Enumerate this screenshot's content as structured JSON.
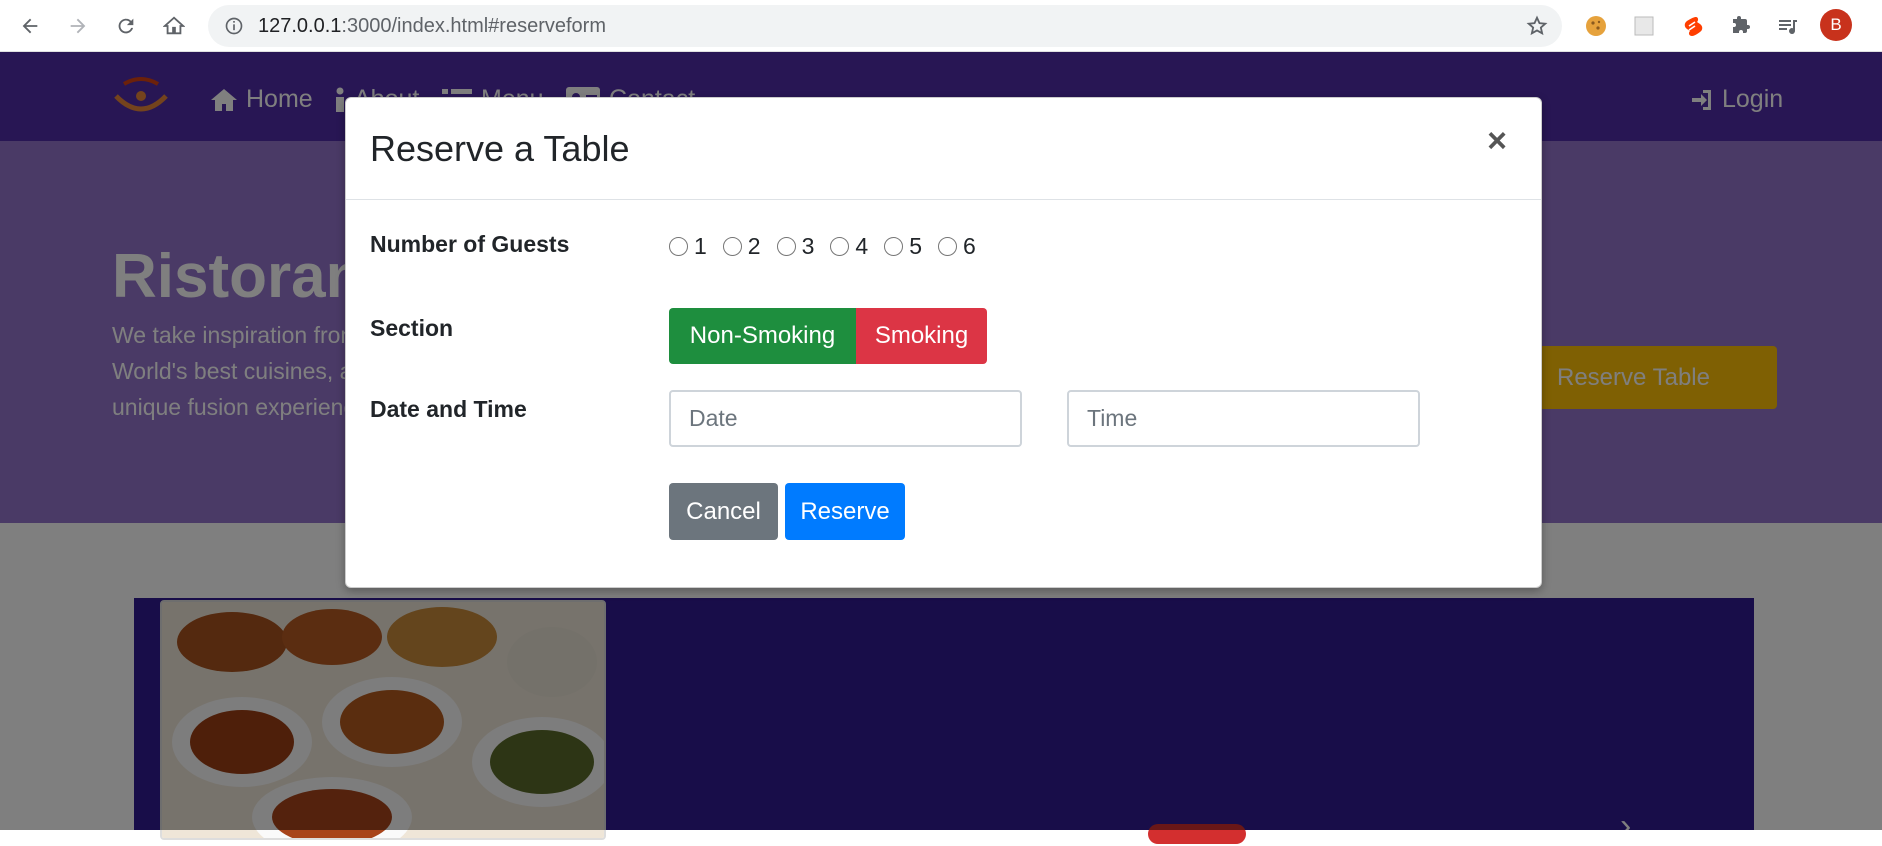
{
  "browser": {
    "url_host": "127.0.0.1",
    "url_rest": ":3000/index.html#reserveform",
    "avatar_letter": "B"
  },
  "navbar": {
    "items": [
      {
        "label": "Home",
        "icon": "home-icon"
      },
      {
        "label": "About",
        "icon": "info-icon"
      },
      {
        "label": "Menu",
        "icon": "list-icon"
      },
      {
        "label": "Contact",
        "icon": "address-card-icon"
      }
    ],
    "login_label": "Login"
  },
  "jumbotron": {
    "title": "Ristorante con Fusion",
    "text": "We take inspiration from the World's best cuisines, and create a unique fusion experience. Our",
    "reserve_label": "Reserve Table"
  },
  "modal": {
    "title": "Reserve a Table",
    "close_label": "×",
    "guests_label": "Number of Guests",
    "guest_options": [
      "1",
      "2",
      "3",
      "4",
      "5",
      "6"
    ],
    "section_label": "Section",
    "non_smoking_label": "Non-Smoking",
    "smoking_label": "Smoking",
    "datetime_label": "Date and Time",
    "date_placeholder": "Date",
    "time_placeholder": "Time",
    "cancel_label": "Cancel",
    "reserve_label": "Reserve"
  },
  "colors": {
    "navbar": "#512da8",
    "jumbotron": "#9575cd",
    "feature": "#311b92",
    "non_smoking": "#1e8e3e",
    "smoking": "#dc3545",
    "reserve": "#007bff",
    "cancel": "#6c757d"
  }
}
